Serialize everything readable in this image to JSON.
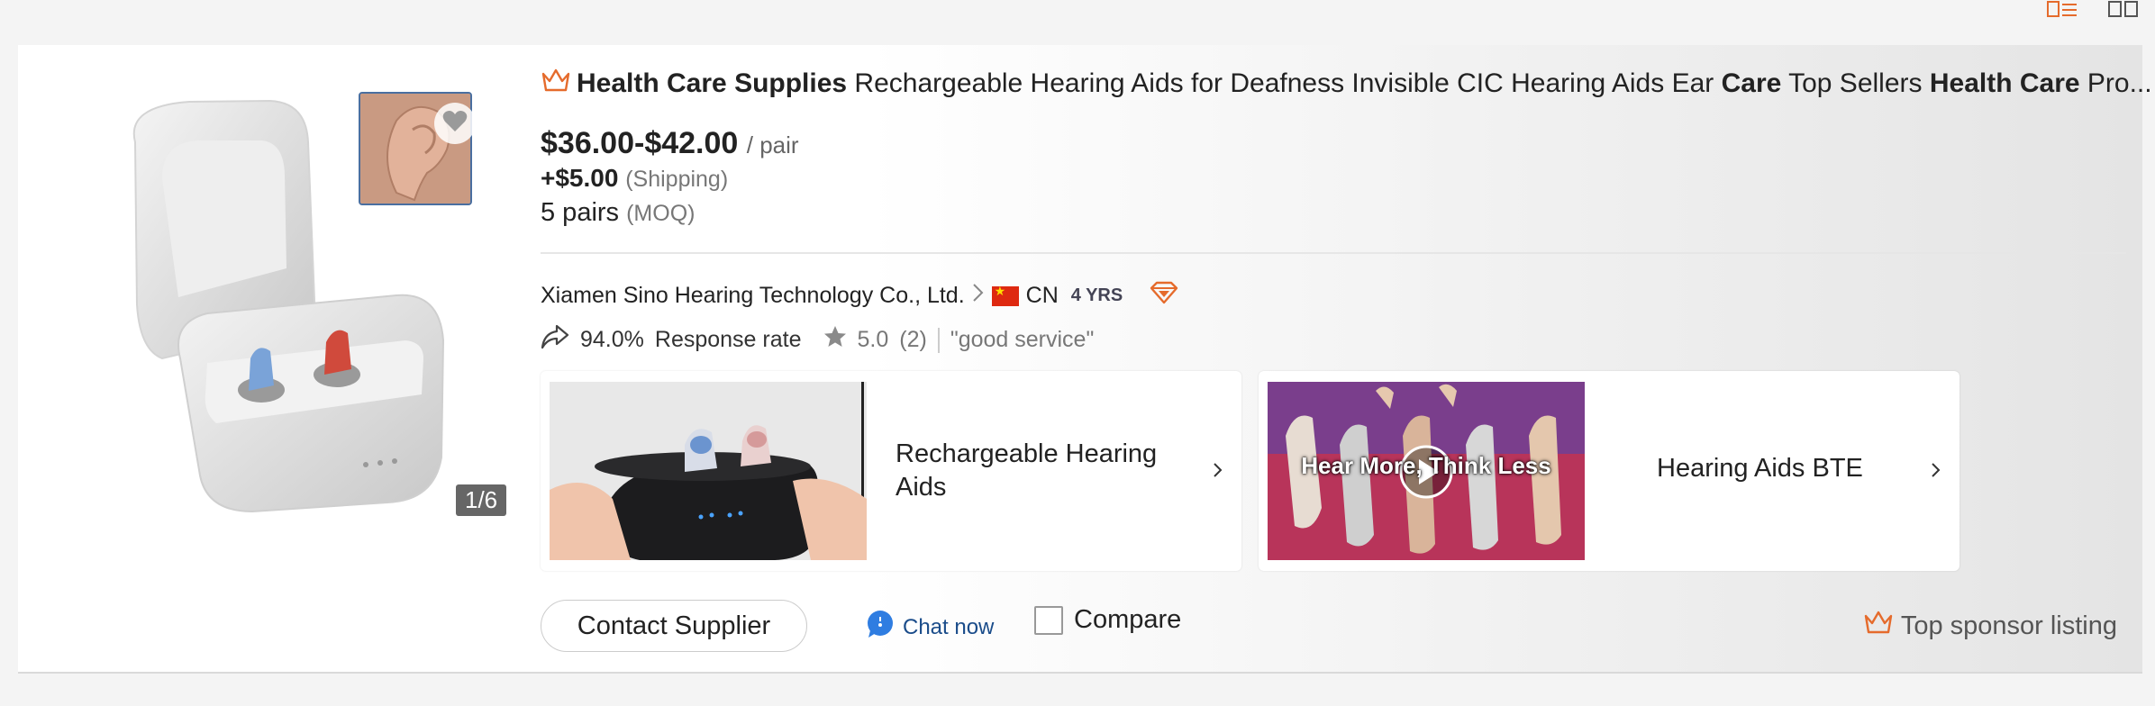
{
  "product": {
    "title_parts": [
      {
        "text": "Health Care Supplies",
        "bold": true
      },
      {
        "text": " Rechargeable Hearing Aids for Deafness Invisible CIC Hearing Aids Ear ",
        "bold": false
      },
      {
        "text": "Care",
        "bold": true
      },
      {
        "text": " Top Sellers ",
        "bold": false
      },
      {
        "text": "Health Care",
        "bold": true
      },
      {
        "text": " Pro...",
        "bold": false
      }
    ],
    "price_range": "$36.00-$42.00",
    "price_unit": "/ pair",
    "shipping_price": "+$5.00",
    "shipping_label": "(Shipping)",
    "moq_value": "5 pairs",
    "moq_label": "(MOQ)",
    "image_counter": "1/6"
  },
  "supplier": {
    "name": "Xiamen Sino Hearing Technology Co., Ltd.",
    "country": "CN",
    "years": "4 YRS",
    "response_rate": "94.0%",
    "response_label": "Response rate",
    "rating": "5.0",
    "review_count": "(2)",
    "review_quote": "\"good service\""
  },
  "promos": [
    {
      "label": "Rechargeable Hearing Aids"
    },
    {
      "label": "Hearing Aids BTE",
      "overlay_text": "Hear More, Think Less"
    }
  ],
  "actions": {
    "contact_label": "Contact Supplier",
    "chat_label": "Chat now",
    "compare_label": "Compare"
  },
  "sponsor_label": "Top sponsor listing",
  "icons": {
    "crown": "crown-icon",
    "heart": "heart-icon",
    "share": "share-icon",
    "star": "star-icon",
    "diamond": "diamond-icon",
    "chat": "chat-bubble-icon"
  },
  "colors": {
    "accent_orange": "#e56b2c",
    "link_blue": "#1a4c8a",
    "chat_blue": "#2f7de1"
  }
}
